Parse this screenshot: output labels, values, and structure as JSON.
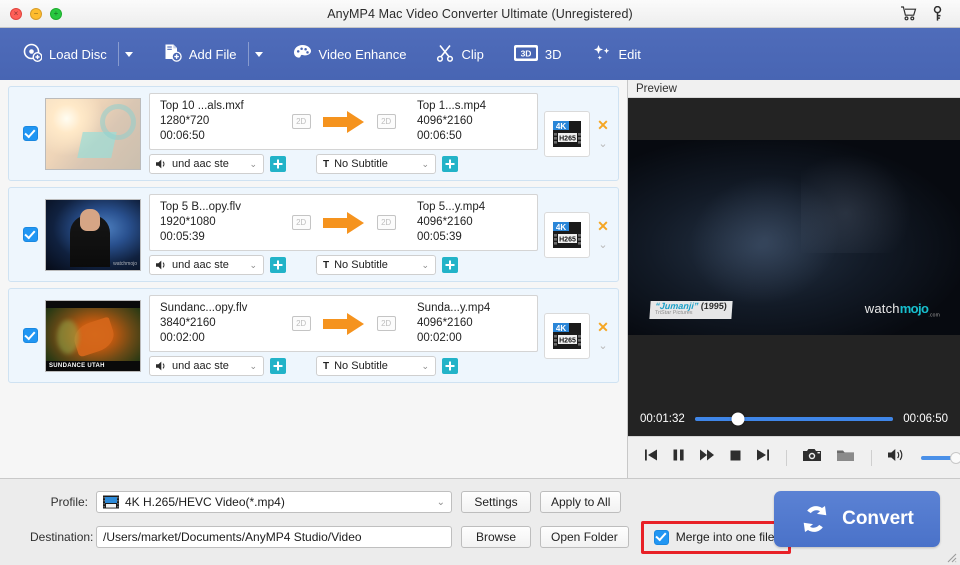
{
  "window": {
    "title": "AnyMP4 Mac Video Converter Ultimate (Unregistered)",
    "traffic": {
      "close": "close-button",
      "minimize": "minimize-button",
      "zoom": "zoom-button"
    },
    "right_icons": [
      {
        "name": "cart-icon",
        "label": "Cart"
      },
      {
        "name": "key-icon",
        "label": "Register"
      }
    ]
  },
  "toolbar": {
    "items": [
      {
        "label": "Load Disc",
        "icon": "disc-add-icon",
        "has_caret": true
      },
      {
        "label": "Add File",
        "icon": "file-add-icon",
        "has_caret": true
      },
      {
        "label": "Video Enhance",
        "icon": "palette-icon",
        "has_caret": false
      },
      {
        "label": "Clip",
        "icon": "scissors-icon",
        "has_caret": false
      },
      {
        "label": "3D",
        "icon": "3d-icon",
        "has_caret": false
      },
      {
        "label": "Edit",
        "icon": "sparkle-icon",
        "has_caret": false
      }
    ]
  },
  "filelist": {
    "rows": [
      {
        "checked": true,
        "thumb_label": "",
        "thumb_watermark": "",
        "source": {
          "name": "Top 10 ...als.mxf",
          "resolution": "1280*720",
          "duration": "00:06:50",
          "badge": "2D"
        },
        "target": {
          "name": "Top 1...s.mp4",
          "resolution": "4096*2160",
          "duration": "00:06:50",
          "badge": "2D"
        },
        "audio_track": "und aac ste",
        "subtitle": "No Subtitle",
        "format_badge": "4K",
        "format_codec": "H265",
        "remove": "✕"
      },
      {
        "checked": true,
        "thumb_label": "",
        "thumb_watermark": "watchmojo",
        "source": {
          "name": "Top 5 B...opy.flv",
          "resolution": "1920*1080",
          "duration": "00:05:39",
          "badge": "2D"
        },
        "target": {
          "name": "Top 5...y.mp4",
          "resolution": "4096*2160",
          "duration": "00:05:39",
          "badge": "2D"
        },
        "audio_track": "und aac ste",
        "subtitle": "No Subtitle",
        "format_badge": "4K",
        "format_codec": "H265",
        "remove": "✕"
      },
      {
        "checked": true,
        "thumb_label": "SUNDANCE UTAH",
        "thumb_watermark": "",
        "source": {
          "name": "Sundanc...opy.flv",
          "resolution": "3840*2160",
          "duration": "00:02:00",
          "badge": "2D"
        },
        "target": {
          "name": "Sunda...y.mp4",
          "resolution": "4096*2160",
          "duration": "00:02:00",
          "badge": "2D"
        },
        "audio_track": "und aac ste",
        "subtitle": "No Subtitle",
        "format_badge": "4K",
        "format_codec": "H265",
        "remove": "✕"
      }
    ]
  },
  "preview": {
    "header": "Preview",
    "overlay": {
      "title_quoted": "“Jumanji”",
      "year": "(1995)",
      "studio": "TriStar Pictures",
      "logo_prefix": "watch",
      "logo_brand": "mojo",
      "logo_suffix": ".com"
    },
    "current_time": "00:01:32",
    "total_time": "00:06:50",
    "progress_percent": 22,
    "volume_percent": 100,
    "controls": [
      {
        "name": "previous-button",
        "glyph": "⏮"
      },
      {
        "name": "pause-button",
        "glyph": "⏸"
      },
      {
        "name": "fast-forward-button",
        "glyph": "⏩"
      },
      {
        "name": "stop-button",
        "glyph": "⏹"
      },
      {
        "name": "next-button",
        "glyph": "⏭"
      },
      {
        "name": "snapshot-button",
        "glyph": "camera"
      },
      {
        "name": "open-folder-button",
        "glyph": "folder"
      },
      {
        "name": "volume-icon",
        "glyph": "speaker"
      }
    ]
  },
  "bottom": {
    "profile_label": "Profile:",
    "profile_value": "4K H.265/HEVC Video(*.mp4)",
    "destination_label": "Destination:",
    "destination_value": "/Users/market/Documents/AnyMP4 Studio/Video",
    "settings_button": "Settings",
    "apply_all_button": "Apply to All",
    "browse_button": "Browse",
    "open_folder_button": "Open Folder",
    "merge_label": "Merge into one file",
    "merge_checked": true,
    "convert_button": "Convert",
    "highlight_color": "#e82127",
    "accent_color": "#4a72c9"
  }
}
